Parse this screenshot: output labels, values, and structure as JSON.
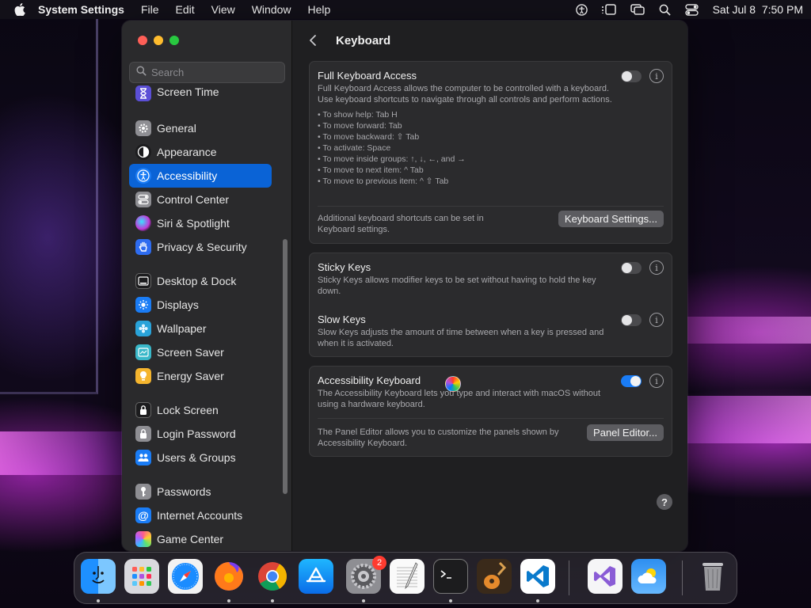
{
  "menubar": {
    "app_name": "System Settings",
    "menus": [
      "File",
      "Edit",
      "View",
      "Window",
      "Help"
    ],
    "clock": "Sat Jul 8  7:50 PM"
  },
  "sidebar": {
    "search_placeholder": "Search",
    "items": [
      {
        "label": "Screen Time",
        "icon": "hourglass-icon",
        "color": "#5b4fd6"
      },
      {
        "label": "General",
        "icon": "gear-icon",
        "color": "#8e8e93"
      },
      {
        "label": "Appearance",
        "icon": "appearance-icon",
        "color": "#1c1c1e"
      },
      {
        "label": "Accessibility",
        "icon": "accessibility-icon",
        "color": "#1a7cf5",
        "active": true
      },
      {
        "label": "Control Center",
        "icon": "control-center-icon",
        "color": "#8e8e93"
      },
      {
        "label": "Siri & Spotlight",
        "icon": "siri-icon",
        "color": "#c13ad8"
      },
      {
        "label": "Privacy & Security",
        "icon": "hand-icon",
        "color": "#2e6cf0"
      },
      {
        "label": "Desktop & Dock",
        "icon": "dock-icon",
        "color": "#1c1c1e"
      },
      {
        "label": "Displays",
        "icon": "sun-icon",
        "color": "#1a7cf5"
      },
      {
        "label": "Wallpaper",
        "icon": "flower-icon",
        "color": "#29a3d9"
      },
      {
        "label": "Screen Saver",
        "icon": "screen-saver-icon",
        "color": "#3ab8c9"
      },
      {
        "label": "Energy Saver",
        "icon": "bulb-icon",
        "color": "#f5b52e"
      },
      {
        "label": "Lock Screen",
        "icon": "lock-icon",
        "color": "#1c1c1e"
      },
      {
        "label": "Login Password",
        "icon": "lock-icon",
        "color": "#8e8e93"
      },
      {
        "label": "Users & Groups",
        "icon": "users-icon",
        "color": "#1a7cf5"
      },
      {
        "label": "Passwords",
        "icon": "key-icon",
        "color": "#8e8e93"
      },
      {
        "label": "Internet Accounts",
        "icon": "at-icon",
        "color": "#1a7cf5"
      },
      {
        "label": "Game Center",
        "icon": "game-center-icon",
        "color": "#f0f0f0"
      }
    ]
  },
  "content": {
    "title": "Keyboard",
    "full_keyboard_access": {
      "title": "Full Keyboard Access",
      "desc": "Full Keyboard Access allows the computer to be controlled with a keyboard. Use keyboard shortcuts to navigate through all controls and perform actions.",
      "enabled": false,
      "bullets": [
        "• To show help: Tab H",
        "• To move forward: Tab",
        "• To move backward: ⇧ Tab",
        "• To activate: Space",
        "• To move inside groups: ↑, ↓, ←, and →",
        "• To move to next item: ^ Tab",
        "• To move to previous item: ^ ⇧ Tab"
      ],
      "footer": "Additional keyboard shortcuts can be set in Keyboard settings.",
      "button": "Keyboard Settings..."
    },
    "sticky_keys": {
      "title": "Sticky Keys",
      "desc": "Sticky Keys allows modifier keys to be set without having to hold the key down.",
      "enabled": false
    },
    "slow_keys": {
      "title": "Slow Keys",
      "desc": "Slow Keys adjusts the amount of time between when a key is pressed and when it is activated.",
      "enabled": false
    },
    "accessibility_keyboard": {
      "title": "Accessibility Keyboard",
      "desc": "The Accessibility Keyboard lets you type and interact with macOS without using a hardware keyboard.",
      "enabled": true,
      "footer": "The Panel Editor allows you to customize the panels shown by Accessibility Keyboard.",
      "button": "Panel Editor..."
    },
    "help": "?"
  },
  "dock": {
    "badge": "2",
    "apps": [
      "finder-icon",
      "launchpad-icon",
      "safari-icon",
      "firefox-icon",
      "chrome-icon",
      "app-store-icon",
      "system-settings-icon",
      "textedit-icon",
      "terminal-icon",
      "garageband-icon",
      "vscode-icon",
      "visual-studio-icon",
      "weather-icon",
      "trash-icon"
    ]
  }
}
